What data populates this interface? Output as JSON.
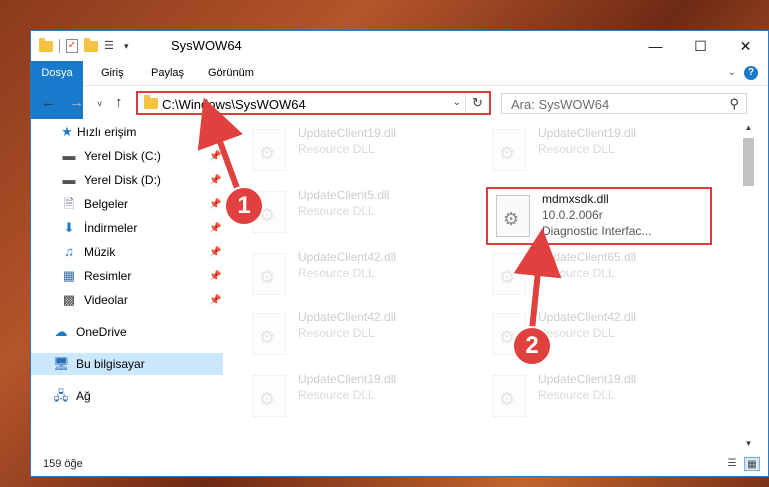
{
  "window": {
    "title": "SysWOW64"
  },
  "ribbon": {
    "tabs": [
      "Dosya",
      "Giriş",
      "Paylaş",
      "Görünüm"
    ],
    "help": "?"
  },
  "address": {
    "path": "C:\\Windows\\SysWOW64"
  },
  "search": {
    "placeholder": "Ara: SysWOW64"
  },
  "sidebar": {
    "items": [
      {
        "label": "Hızlı erişim",
        "icon": "star-icon",
        "pinned": false
      },
      {
        "label": "Yerel Disk (C:)",
        "icon": "drive-icon",
        "pinned": true
      },
      {
        "label": "Yerel Disk (D:)",
        "icon": "drive-icon",
        "pinned": true
      },
      {
        "label": "Belgeler",
        "icon": "documents-icon",
        "pinned": true
      },
      {
        "label": "İndirmeler",
        "icon": "download-icon",
        "pinned": true
      },
      {
        "label": "Müzik",
        "icon": "music-icon",
        "pinned": true
      },
      {
        "label": "Resimler",
        "icon": "pictures-icon",
        "pinned": true
      },
      {
        "label": "Videolar",
        "icon": "videos-icon",
        "pinned": true
      },
      {
        "label": "OneDrive",
        "icon": "cloud-icon",
        "pinned": false
      },
      {
        "label": "Bu bilgisayar",
        "icon": "computer-icon",
        "pinned": false,
        "selected": true
      },
      {
        "label": "Ağ",
        "icon": "network-icon",
        "pinned": false
      }
    ]
  },
  "files": [
    {
      "name": "UpdateClient19.dll",
      "line2": "Resource DLL",
      "line3": "",
      "faded": true
    },
    {
      "name": "UpdateClient19.dll",
      "line2": "Resource DLL",
      "line3": "",
      "faded": true
    },
    {
      "name": "UpdateClient5.dll",
      "line2": "Resource DLL",
      "line3": "",
      "faded": true
    },
    {
      "name": "mdmxsdk.dll",
      "line2": "10.0.2.006r",
      "line3": "Diagnostic Interfac...",
      "faded": false,
      "highlight": true
    },
    {
      "name": "UpdateClient42.dll",
      "line2": "Resource DLL",
      "line3": "",
      "faded": true
    },
    {
      "name": "UpdateClient65.dll",
      "line2": "Resource DLL",
      "line3": "",
      "faded": true
    },
    {
      "name": "UpdateClient42.dll",
      "line2": "Resource DLL",
      "line3": "",
      "faded": true
    },
    {
      "name": "UpdateClient42.dll",
      "line2": "Resource DLL",
      "line3": "",
      "faded": true
    },
    {
      "name": "UpdateClient19.dll",
      "line2": "Resource DLL",
      "line3": "",
      "faded": true
    },
    {
      "name": "UpdateClient19.dll",
      "line2": "Resource DLL",
      "line3": "",
      "faded": true
    }
  ],
  "status": {
    "count": "159 öğe"
  },
  "callouts": [
    "1",
    "2"
  ],
  "colors": {
    "accent": "#1979ca",
    "highlight": "#e23b3b",
    "selected": "#cce8ff"
  }
}
